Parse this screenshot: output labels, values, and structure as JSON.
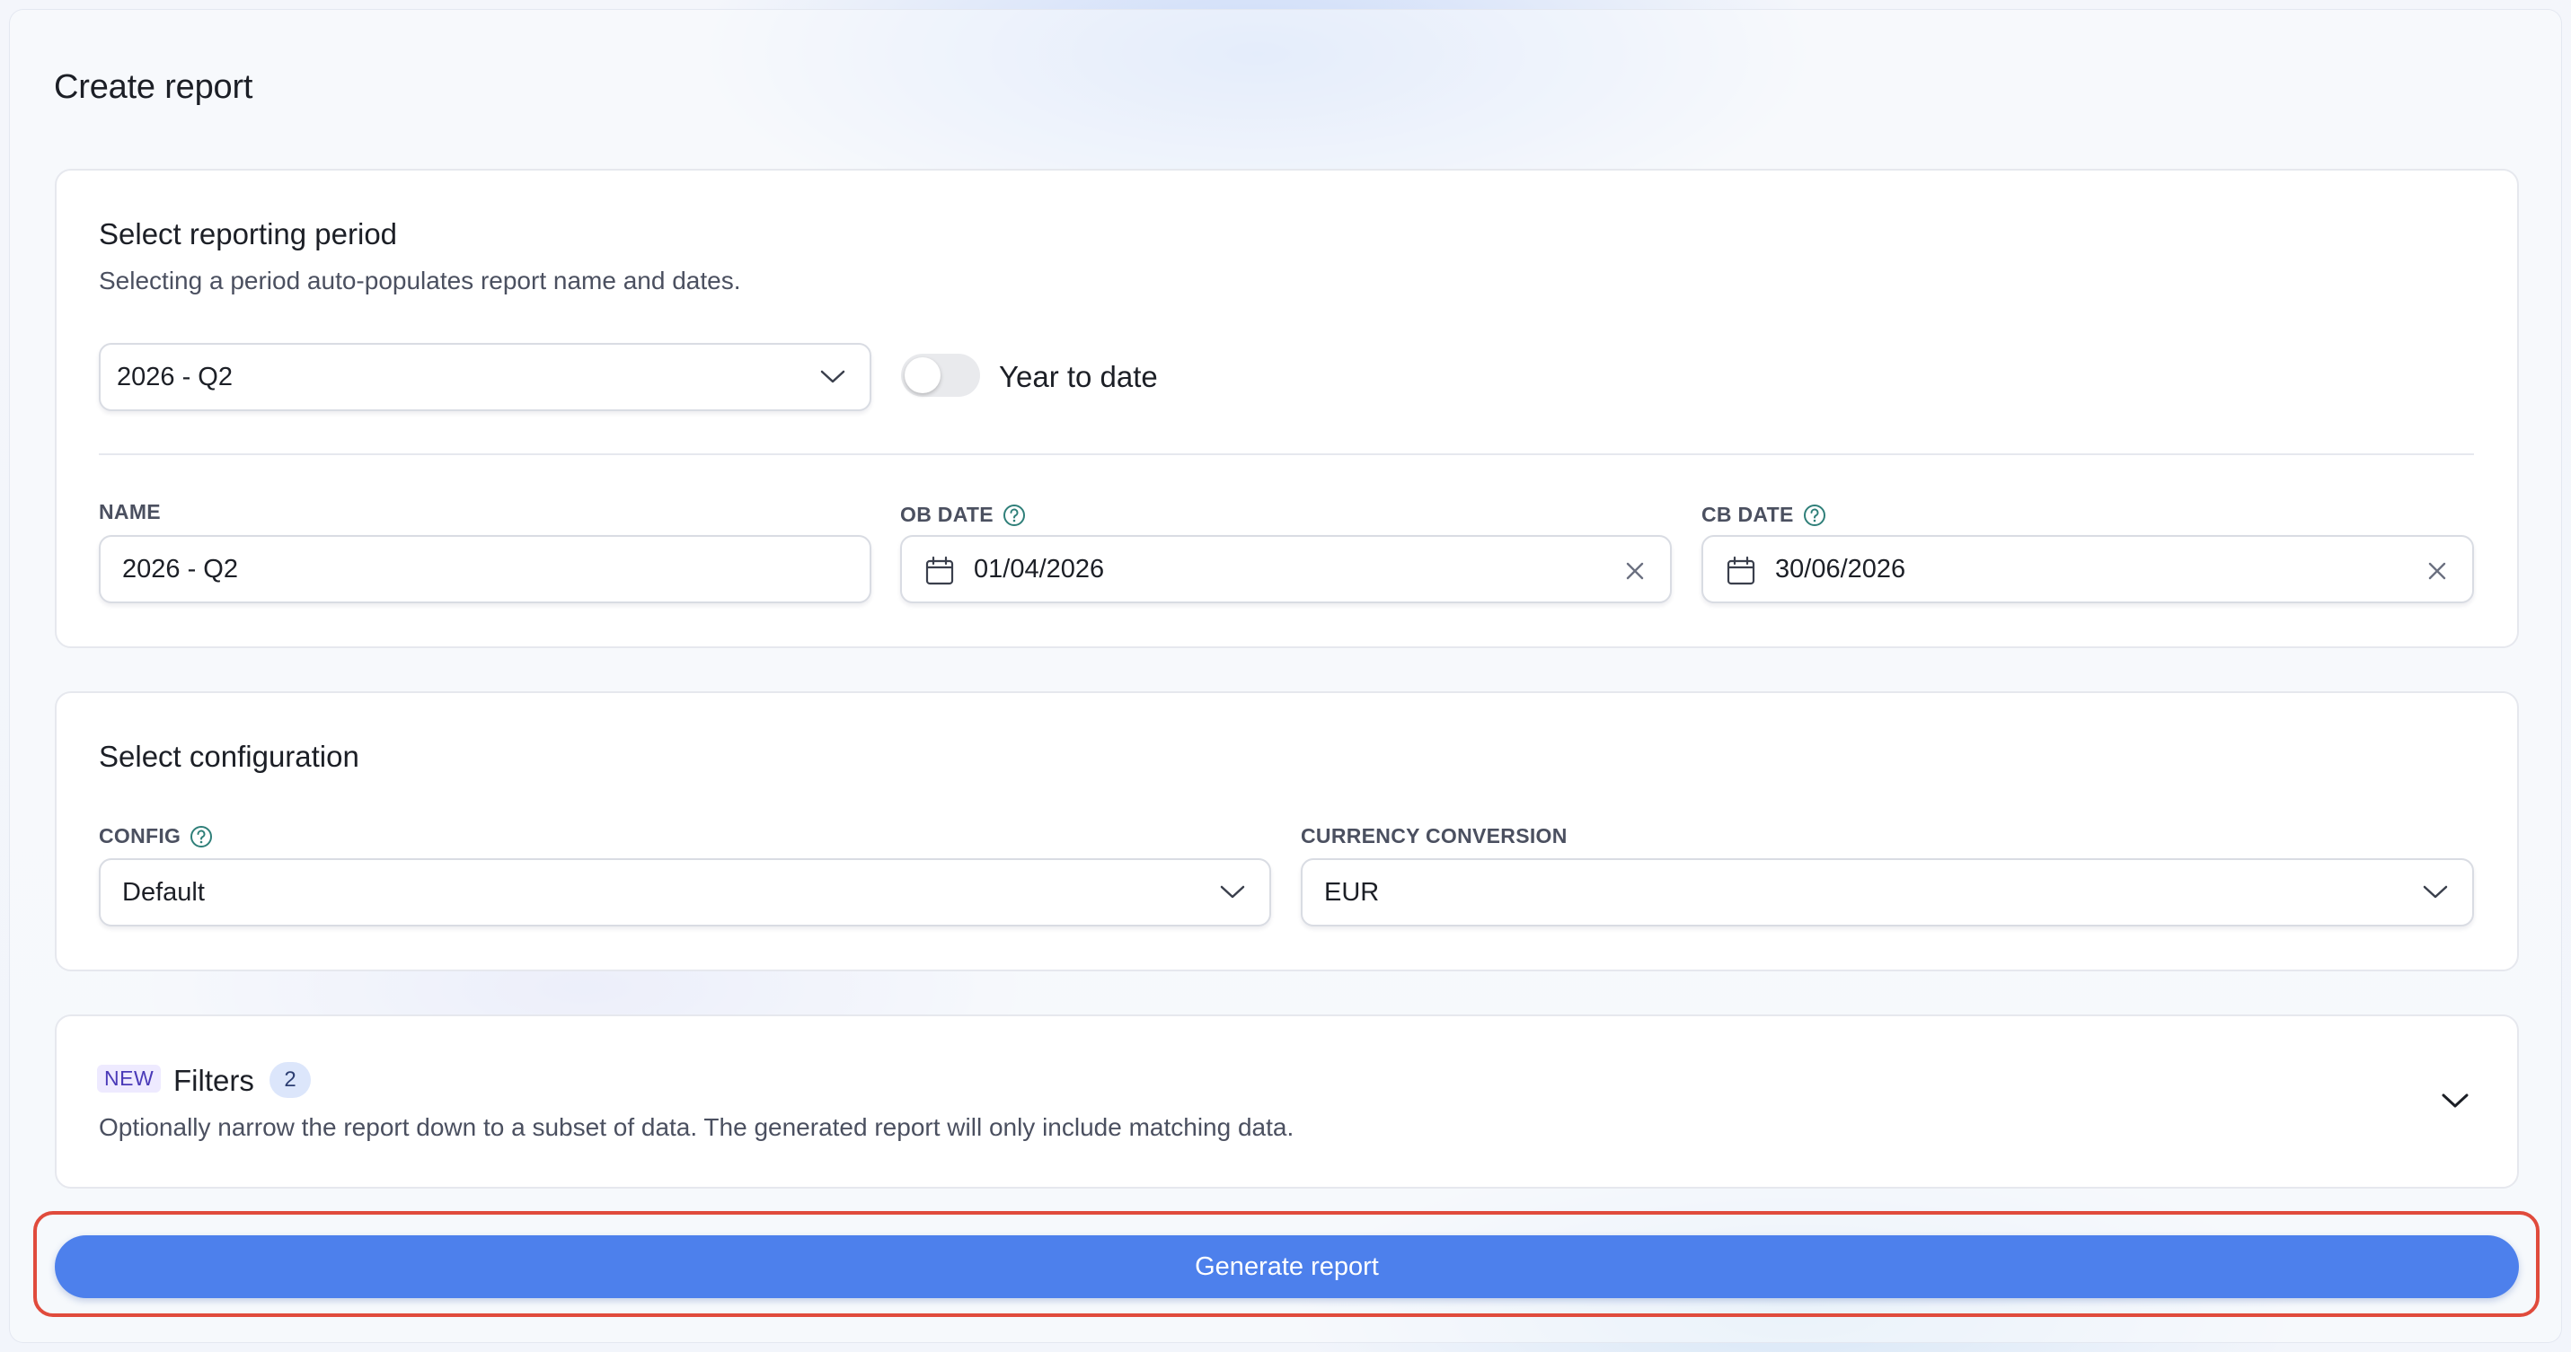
{
  "page": {
    "title": "Create report"
  },
  "period": {
    "title": "Select reporting period",
    "subtitle": "Selecting a period auto-populates report name and dates.",
    "select_value": "2026 - Q2",
    "toggle_label": "Year to date",
    "toggle_on": false,
    "name_label": "NAME",
    "name_value": "2026 - Q2",
    "ob_label": "OB DATE",
    "ob_value": "01/04/2026",
    "cb_label": "CB DATE",
    "cb_value": "30/06/2026"
  },
  "config": {
    "title": "Select configuration",
    "config_label": "CONFIG",
    "config_value": "Default",
    "currency_label": "CURRENCY CONVERSION",
    "currency_value": "EUR"
  },
  "filters": {
    "badge": "NEW",
    "title": "Filters",
    "count": "2",
    "description": "Optionally narrow the report down to a subset of data. The generated report will only include matching data."
  },
  "actions": {
    "generate_label": "Generate report"
  },
  "colors": {
    "primary": "#4d80ec",
    "highlight": "#e04b3c",
    "help_icon": "#2f7f79"
  },
  "icons": [
    "chevron-down-icon",
    "calendar-icon",
    "close-icon",
    "help-icon"
  ]
}
